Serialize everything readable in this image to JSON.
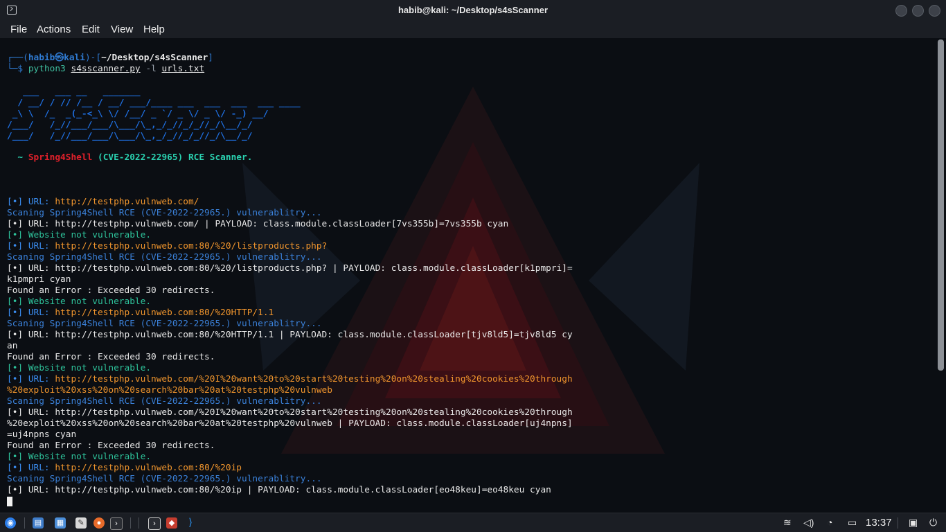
{
  "window": {
    "title": "habib@kali: ~/Desktop/s4sScanner"
  },
  "menu": {
    "file": "File",
    "actions": "Actions",
    "edit": "Edit",
    "view": "View",
    "help": "Help"
  },
  "prompt": {
    "line1_prefix": "┌──(",
    "user": "habib㉿kali",
    "mid": ")-[",
    "path": "~/Desktop/s4sScanner",
    "close": "]",
    "line2_prefix": "└─$ ",
    "cmd_name": "python3",
    "cmd_script": "s4sscanner.py",
    "cmd_flag": "-l",
    "cmd_arg": "urls.txt"
  },
  "banner": {
    "ascii1": "   ___   ___ __   _______",
    "ascii2": "  / __/ / // /__ / __/ ___/____ ___  ___  ___  ___ ____",
    "ascii3": " _\\ \\  /_  _(_-<_\\ \\/ /__/ _ `/ _ \\/ _ \\/ -_) __/",
    "ascii4": "/___/   /_//___/___/\\___/\\_,_/_//_/_//_/\\__/_/",
    "tilde": "  ~ ",
    "name": "Spring4Shell",
    "desc": " (CVE-2022-22965) RCE Scanner."
  },
  "log": [
    {
      "cls": "blue",
      "text": "[•] URL: ",
      "rest_cls": "orange",
      "rest": "http://testphp.vulnweb.com/"
    },
    {
      "cls": "scan",
      "text": "Scaning Spring4Shell RCE (CVE-2022-22965.) vulnerablitry...",
      "rest_cls": "",
      "rest": ""
    },
    {
      "cls": "white",
      "text": "[•] URL: http://testphp.vulnweb.com/ | PAYLOAD: class.module.classLoader[7vs355b]=7vs355b cyan",
      "rest_cls": "",
      "rest": ""
    },
    {
      "cls": "teal",
      "text": "[•] Website not vulnerable.",
      "rest_cls": "",
      "rest": ""
    },
    {
      "cls": "blue",
      "text": "[•] URL: ",
      "rest_cls": "orange",
      "rest": "http://testphp.vulnweb.com:80/%20/listproducts.php?"
    },
    {
      "cls": "scan",
      "text": "Scaning Spring4Shell RCE (CVE-2022-22965.) vulnerablitry...",
      "rest_cls": "",
      "rest": ""
    },
    {
      "cls": "white",
      "text": "[•] URL: http://testphp.vulnweb.com:80/%20/listproducts.php? | PAYLOAD: class.module.classLoader[k1pmpri]=",
      "rest_cls": "",
      "rest": ""
    },
    {
      "cls": "white",
      "text": "k1pmpri cyan",
      "rest_cls": "",
      "rest": ""
    },
    {
      "cls": "white",
      "text": "Found an Error : Exceeded 30 redirects.",
      "rest_cls": "",
      "rest": ""
    },
    {
      "cls": "teal",
      "text": "[•] Website not vulnerable.",
      "rest_cls": "",
      "rest": ""
    },
    {
      "cls": "blue",
      "text": "[•] URL: ",
      "rest_cls": "orange",
      "rest": "http://testphp.vulnweb.com:80/%20HTTP/1.1"
    },
    {
      "cls": "scan",
      "text": "Scaning Spring4Shell RCE (CVE-2022-22965.) vulnerablitry...",
      "rest_cls": "",
      "rest": ""
    },
    {
      "cls": "white",
      "text": "[•] URL: http://testphp.vulnweb.com:80/%20HTTP/1.1 | PAYLOAD: class.module.classLoader[tjv8ld5]=tjv8ld5 cy",
      "rest_cls": "",
      "rest": ""
    },
    {
      "cls": "white",
      "text": "an",
      "rest_cls": "",
      "rest": ""
    },
    {
      "cls": "white",
      "text": "Found an Error : Exceeded 30 redirects.",
      "rest_cls": "",
      "rest": ""
    },
    {
      "cls": "teal",
      "text": "[•] Website not vulnerable.",
      "rest_cls": "",
      "rest": ""
    },
    {
      "cls": "blue",
      "text": "[•] URL: ",
      "rest_cls": "orange",
      "rest": "http://testphp.vulnweb.com/%20I%20want%20to%20start%20testing%20on%20stealing%20cookies%20through"
    },
    {
      "cls": "orange",
      "text": "%20exploit%20xss%20on%20search%20bar%20at%20testphp%20vulnweb",
      "rest_cls": "",
      "rest": ""
    },
    {
      "cls": "scan",
      "text": "Scaning Spring4Shell RCE (CVE-2022-22965.) vulnerablitry...",
      "rest_cls": "",
      "rest": ""
    },
    {
      "cls": "white",
      "text": "[•] URL: http://testphp.vulnweb.com/%20I%20want%20to%20start%20testing%20on%20stealing%20cookies%20through",
      "rest_cls": "",
      "rest": ""
    },
    {
      "cls": "white",
      "text": "%20exploit%20xss%20on%20search%20bar%20at%20testphp%20vulnweb | PAYLOAD: class.module.classLoader[uj4npns]",
      "rest_cls": "",
      "rest": ""
    },
    {
      "cls": "white",
      "text": "=uj4npns cyan",
      "rest_cls": "",
      "rest": ""
    },
    {
      "cls": "white",
      "text": "Found an Error : Exceeded 30 redirects.",
      "rest_cls": "",
      "rest": ""
    },
    {
      "cls": "teal",
      "text": "[•] Website not vulnerable.",
      "rest_cls": "",
      "rest": ""
    },
    {
      "cls": "blue",
      "text": "[•] URL: ",
      "rest_cls": "orange",
      "rest": "http://testphp.vulnweb.com:80/%20ip"
    },
    {
      "cls": "scan",
      "text": "Scaning Spring4Shell RCE (CVE-2022-22965.) vulnerablitry...",
      "rest_cls": "",
      "rest": ""
    },
    {
      "cls": "white",
      "text": "[•] URL: http://testphp.vulnweb.com:80/%20ip | PAYLOAD: class.module.classLoader[eo48keu]=eo48keu cyan",
      "rest_cls": "",
      "rest": ""
    }
  ],
  "taskbar": {
    "clock": "13:37"
  },
  "colors": {
    "accent": "#2f7bd3",
    "url": "#f0952d",
    "ok": "#2ec39b",
    "banner_red": "#e0202a"
  }
}
